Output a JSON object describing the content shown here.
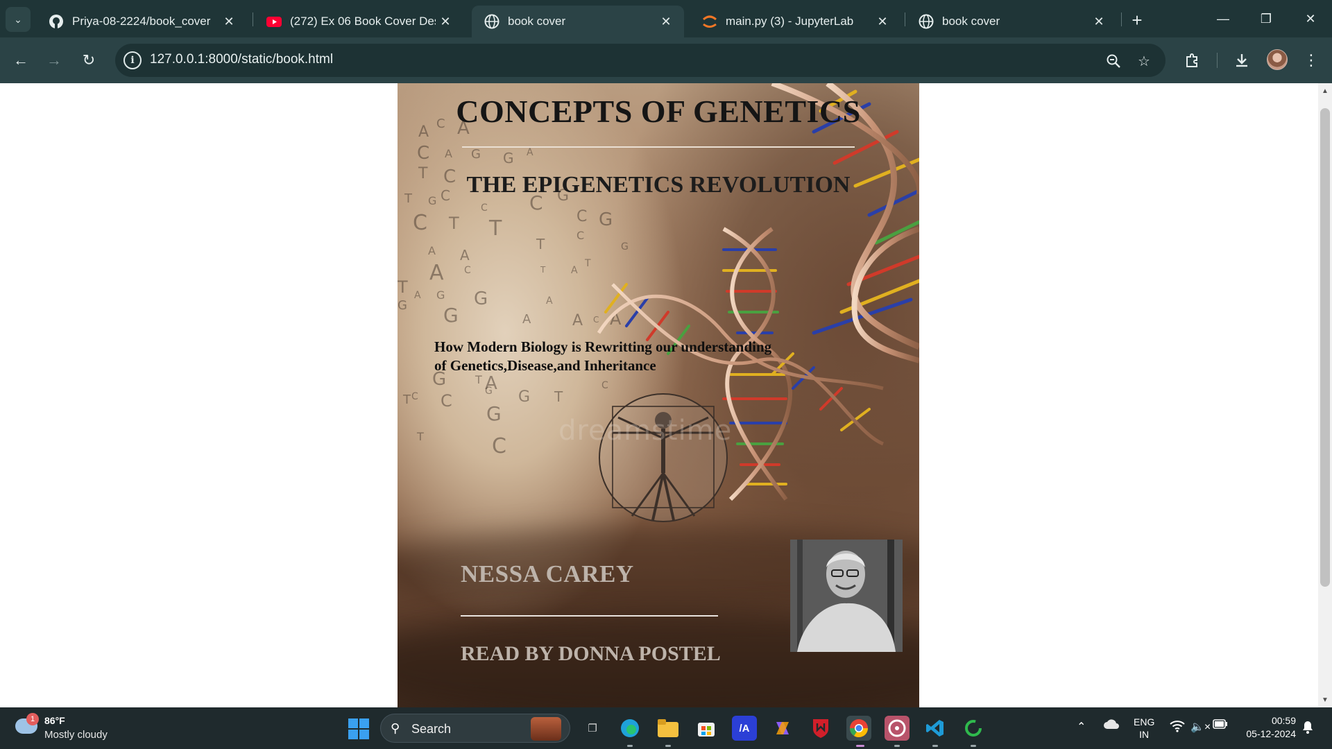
{
  "browser": {
    "tabs": [
      {
        "title": "Priya-08-2224/book_cover",
        "icon": "github-icon"
      },
      {
        "title": "(272) Ex 06 Book Cover Desig",
        "icon": "youtube-icon"
      },
      {
        "title": "book cover",
        "icon": "globe-icon",
        "active": true
      },
      {
        "title": "main.py (3) - JupyterLab",
        "icon": "jupyter-icon"
      },
      {
        "title": "book cover",
        "icon": "globe-icon"
      }
    ],
    "url": "127.0.0.1:8000/static/book.html"
  },
  "cover": {
    "title": "CONCEPTS OF GENETICS",
    "subtitle": "THE EPIGENETICS REVOLUTION",
    "tagline_line1": "How Modern Biology is Rewritting our understanding",
    "tagline_line2": "of Genetics,Disease,and Inheritance",
    "watermark": "dreamstime",
    "author": "NESSA CAREY",
    "reader": "READ BY DONNA POSTEL"
  },
  "taskbar": {
    "weather_badge": "1",
    "temperature": "86°F",
    "weather": "Mostly cloudy",
    "search_label": "Search",
    "lang_line1": "ENG",
    "lang_line2": "IN",
    "time": "00:59",
    "date": "05-12-2024"
  },
  "colors": {
    "tab_strip": "#1f3537",
    "toolbar": "#2b4346",
    "taskbar": "#1f2a2d",
    "cover_title": "#151515",
    "cover_author": "#bdb3aa"
  }
}
